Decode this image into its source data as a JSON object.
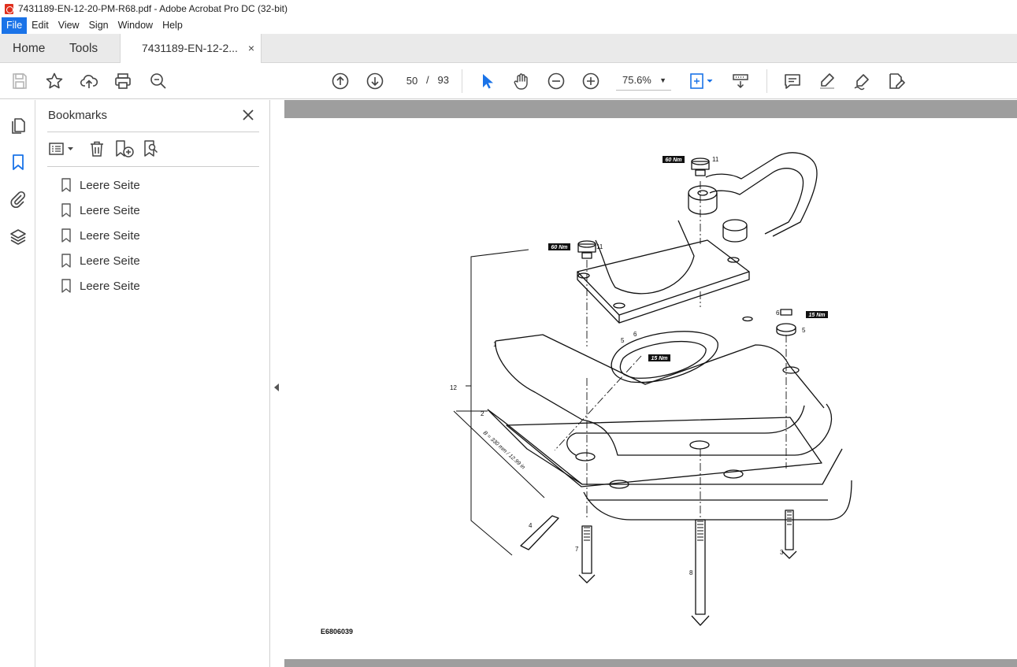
{
  "window": {
    "title": "7431189-EN-12-20-PM-R68.pdf - Adobe Acrobat Pro DC (32-bit)"
  },
  "menu": [
    "File",
    "Edit",
    "View",
    "Sign",
    "Window",
    "Help"
  ],
  "tabs": {
    "home": "Home",
    "tools": "Tools",
    "document": "7431189-EN-12-2...",
    "close": "×"
  },
  "toolbar": {
    "page_current": "50",
    "page_sep": "/",
    "page_total": "93",
    "zoom": "75.6%",
    "zoom_caret": "▼"
  },
  "bookmarks_panel": {
    "title": "Bookmarks",
    "items": [
      {
        "label": "Leere Seite"
      },
      {
        "label": "Leere Seite"
      },
      {
        "label": "Leere Seite"
      },
      {
        "label": "Leere Seite"
      },
      {
        "label": "Leere Seite"
      }
    ]
  },
  "drawing": {
    "figure_id": "E6806039",
    "torque_60": "60 Nm",
    "torque_15": "15 Nm",
    "dimension": "B = 330 mm / 12.99 in",
    "callouts": [
      "1",
      "2",
      "3",
      "4",
      "5",
      "6",
      "7",
      "8",
      "11",
      "12"
    ]
  },
  "colors": {
    "accent": "#1a73e8",
    "pdf_red": "#e0301e",
    "doc_background": "#9e9e9e"
  }
}
